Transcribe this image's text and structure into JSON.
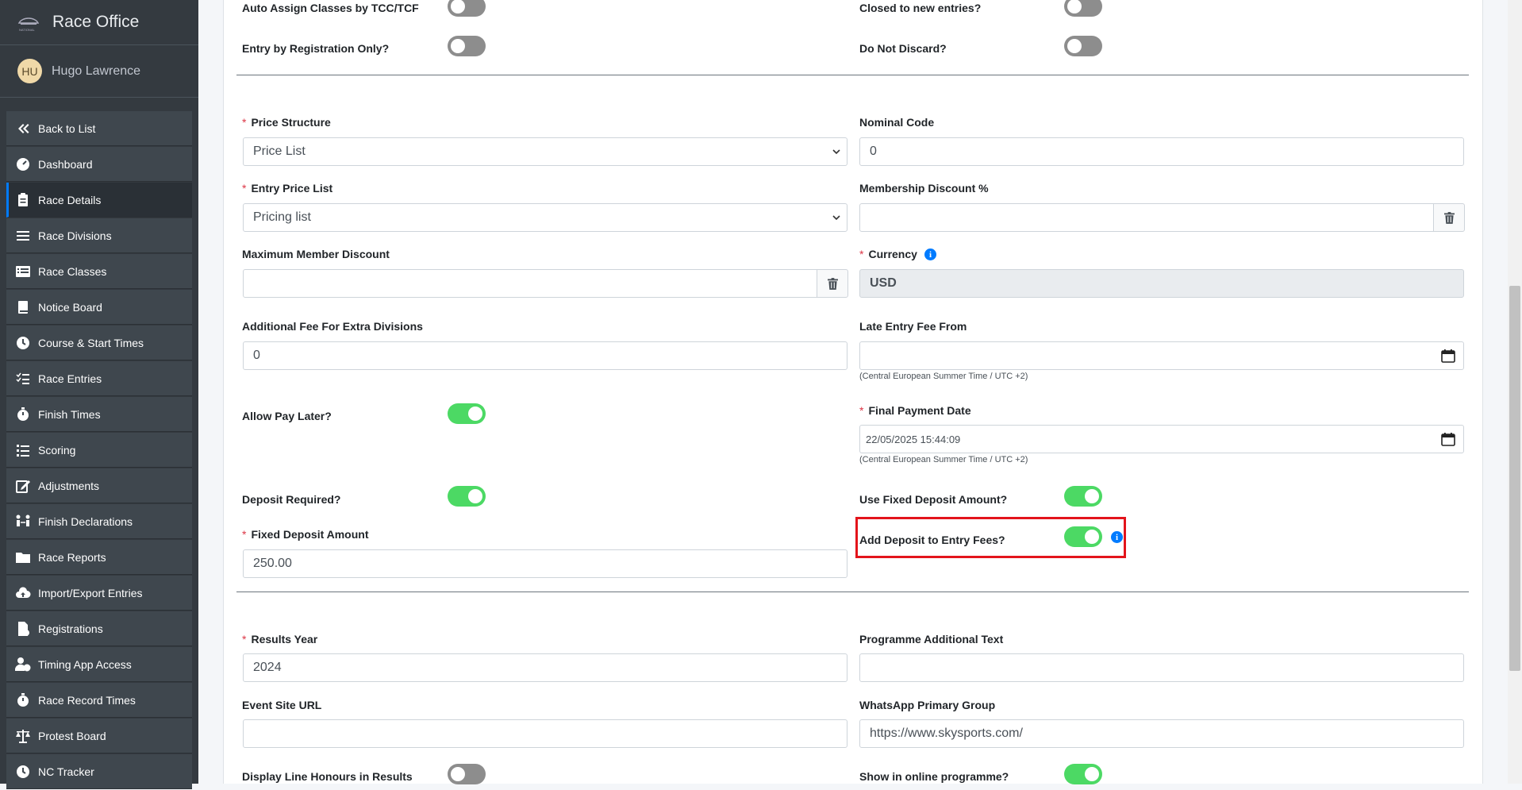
{
  "app": {
    "title": "Race Office",
    "user_name": "Hugo Lawrence",
    "user_initials": "HU"
  },
  "sidebar": {
    "items": [
      {
        "label": "Back to List",
        "icon": "double-chevron-left-icon"
      },
      {
        "label": "Dashboard",
        "icon": "dashboard-gauge-icon"
      },
      {
        "label": "Race Details",
        "icon": "clipboard-icon",
        "active": true
      },
      {
        "label": "Race Divisions",
        "icon": "bars-icon"
      },
      {
        "label": "Race Classes",
        "icon": "list-icon"
      },
      {
        "label": "Notice Board",
        "icon": "book-icon"
      },
      {
        "label": "Course & Start Times",
        "icon": "clock-icon"
      },
      {
        "label": "Race Entries",
        "icon": "checklist-icon"
      },
      {
        "label": "Finish Times",
        "icon": "stopwatch-icon"
      },
      {
        "label": "Scoring",
        "icon": "ordered-list-icon"
      },
      {
        "label": "Adjustments",
        "icon": "edit-icon"
      },
      {
        "label": "Finish Declarations",
        "icon": "people-arrows-icon"
      },
      {
        "label": "Race Reports",
        "icon": "folder-icon"
      },
      {
        "label": "Import/Export Entries",
        "icon": "cloud-upload-icon"
      },
      {
        "label": "Registrations",
        "icon": "file-plus-icon"
      },
      {
        "label": "Timing App Access",
        "icon": "user-clock-icon"
      },
      {
        "label": "Race Record Times",
        "icon": "stopwatch-icon"
      },
      {
        "label": "Protest Board",
        "icon": "scale-icon"
      },
      {
        "label": "NC Tracker",
        "icon": "clock-icon"
      }
    ]
  },
  "form": {
    "auto_assign_label": "Auto Assign Classes by TCC/TCF",
    "auto_assign_on": false,
    "closed_label": "Closed to new entries?",
    "closed_on": false,
    "entry_reg_label": "Entry by Registration Only?",
    "entry_reg_on": false,
    "do_not_discard_label": "Do Not Discard?",
    "do_not_discard_on": false,
    "price_structure_label": "Price Structure",
    "price_structure_value": "Price List",
    "nominal_code_label": "Nominal Code",
    "nominal_code_value": "0",
    "entry_price_list_label": "Entry Price List",
    "entry_price_list_value": "Pricing list",
    "membership_discount_label": "Membership Discount %",
    "membership_discount_value": "",
    "max_member_discount_label": "Maximum Member Discount",
    "max_member_discount_value": "",
    "currency_label": "Currency",
    "currency_value": "USD",
    "additional_fee_label": "Additional Fee For Extra Divisions",
    "additional_fee_value": "0",
    "late_entry_label": "Late Entry Fee From",
    "late_entry_value": "",
    "timezone_hint": "(Central European Summer Time / UTC +2)",
    "allow_pay_later_label": "Allow Pay Later?",
    "allow_pay_later_on": true,
    "final_payment_label": "Final Payment Date",
    "final_payment_value": "22/05/2025 15:44:09",
    "deposit_required_label": "Deposit Required?",
    "deposit_required_on": true,
    "use_fixed_deposit_label": "Use Fixed Deposit Amount?",
    "use_fixed_deposit_on": true,
    "fixed_deposit_label": "Fixed Deposit Amount",
    "fixed_deposit_value": "250.00",
    "add_deposit_label": "Add Deposit to Entry Fees?",
    "add_deposit_on": true,
    "results_year_label": "Results Year",
    "results_year_value": "2024",
    "programme_text_label": "Programme Additional Text",
    "programme_text_value": "",
    "event_site_label": "Event Site URL",
    "event_site_value": "",
    "whatsapp_label": "WhatsApp Primary Group",
    "whatsapp_value": "https://www.skysports.com/",
    "line_honours_label": "Display Line Honours in Results",
    "line_honours_on": false,
    "online_programme_label": "Show in online programme?",
    "online_programme_on": true
  },
  "colors": {
    "toggle_on": "#4cd964",
    "toggle_off": "#8d8d8d",
    "highlight": "#e3141b",
    "sidebar_bg": "#343a40"
  }
}
